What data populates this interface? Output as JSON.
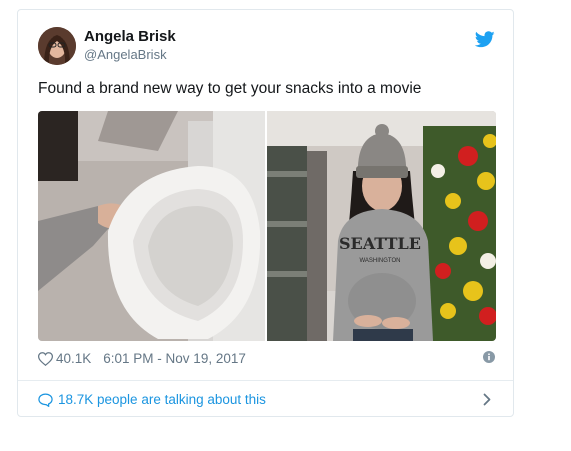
{
  "tweet": {
    "author_name": "Angela Brisk",
    "author_handle": "@AngelaBrisk",
    "text": "Found a brand new way to get your snacks into a movie",
    "media": {
      "left_image": "styrofoam-half-sphere",
      "right_image": "woman-with-fake-belly",
      "sweater_text": "SEATTLE",
      "sweater_subtext": "WASHINGTON"
    },
    "likes": "40.1K",
    "timestamp": "6:01 PM - Nov 19, 2017",
    "talking": "18.7K people are talking about this"
  },
  "icons": {
    "brand": "twitter-bird-icon",
    "like": "heart-icon",
    "info": "info-icon",
    "reply": "speech-bubble-icon",
    "more": "chevron-right-icon"
  },
  "colors": {
    "twitter_blue": "#1da1f2",
    "link_blue": "#1b95e0",
    "muted": "#657786",
    "text": "#14171a",
    "border": "#e1e8ed"
  }
}
